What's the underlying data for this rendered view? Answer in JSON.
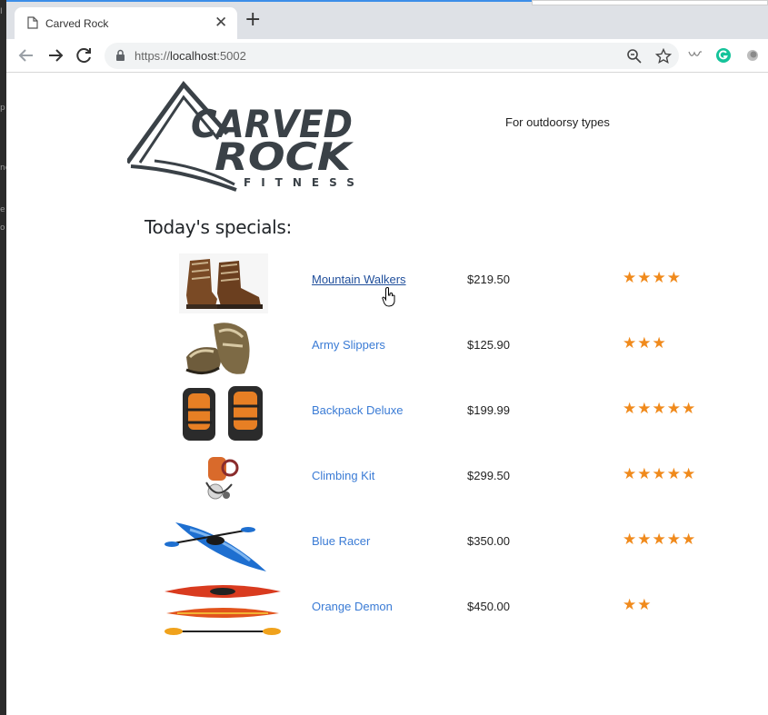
{
  "browser": {
    "tab_title": "Carved Rock",
    "url_scheme": "https://",
    "url_host": "localhost",
    "url_port": ":5002"
  },
  "site": {
    "brand_top": "CARVED",
    "brand_mid": "ROCK",
    "brand_sub": "FITNESS",
    "tagline": "For outdoorsy types",
    "specials_heading": "Today's specials:"
  },
  "products": [
    {
      "name": "Mountain Walkers",
      "price": "$219.50",
      "stars": "★★★★",
      "rating": 4,
      "image": "hiking-boots-image"
    },
    {
      "name": "Army Slippers",
      "price": "$125.90",
      "stars": "★★★",
      "rating": 3,
      "image": "sandals-image"
    },
    {
      "name": "Backpack Deluxe",
      "price": "$199.99",
      "stars": "★★★★★",
      "rating": 5,
      "image": "backpacks-image"
    },
    {
      "name": "Climbing Kit",
      "price": "$299.50",
      "stars": "★★★★★",
      "rating": 5,
      "image": "climbing-gear-image"
    },
    {
      "name": "Blue Racer",
      "price": "$350.00",
      "stars": "★★★★★",
      "rating": 5,
      "image": "blue-kayak-image"
    },
    {
      "name": "Orange Demon",
      "price": "$450.00",
      "stars": "★★",
      "rating": 2,
      "image": "orange-kayak-image"
    }
  ],
  "colors": {
    "link": "#3a7bd5",
    "link_hover": "#1f4e9b",
    "star": "#f08a1c",
    "logo": "#3a4147"
  }
}
